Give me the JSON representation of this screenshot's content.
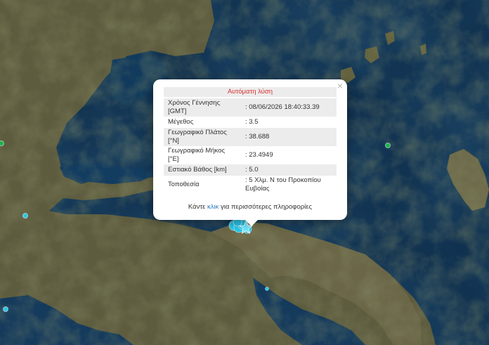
{
  "popup": {
    "close_symbol": "×",
    "title": "Αυτόματη λύση",
    "rows": [
      {
        "label": "Χρόνος Γέννησης [GMT]",
        "value": ": 08/06/2026 18:40:33.39"
      },
      {
        "label": "Μέγεθος",
        "value": ": 3.5"
      },
      {
        "label": "Γεωγραφικό Πλάτος [°N]",
        "value": ": 38.688"
      },
      {
        "label": "Γεωγραφικό Μήκος [°E]",
        "value": ": 23.4949"
      },
      {
        "label": "Εστιακό Βάθος [km]",
        "value": ": 5.0"
      },
      {
        "label": "Τοποθεσία",
        "value": ": 5 Χλμ. Ν του Προκοπίου Ευβοίας"
      }
    ],
    "more_prefix": "Κάντε ",
    "more_link": "κλικ",
    "more_suffix": " για περισσότερες πληροφορίες"
  },
  "colors": {
    "sea": "#0d2a45",
    "land": "#5b5a3e",
    "marker_recent": "#29c6e6",
    "marker_older": "#19b34d",
    "popup_title_text": "#d9302d",
    "link": "#2a78c4"
  },
  "markers": [
    {
      "type": "recent",
      "name": "earthquake-marker"
    },
    {
      "type": "older",
      "name": "earthquake-marker"
    },
    {
      "type": "older",
      "name": "earthquake-marker"
    }
  ]
}
